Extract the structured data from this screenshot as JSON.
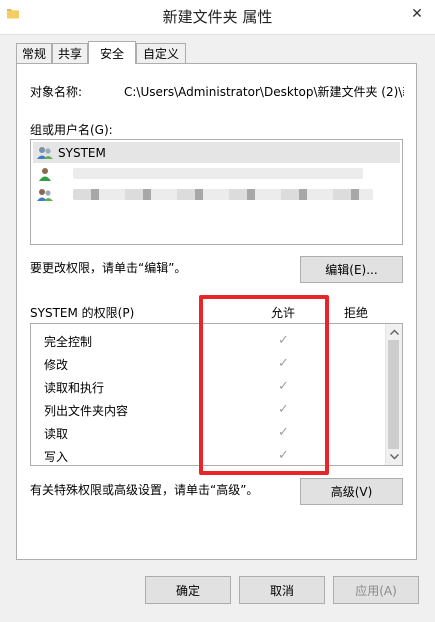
{
  "window": {
    "title": "新建文件夹 属性",
    "close_glyph": "✕"
  },
  "tabs": [
    {
      "label": "常规"
    },
    {
      "label": "共享"
    },
    {
      "label": "安全"
    },
    {
      "label": "自定义"
    }
  ],
  "object": {
    "label": "对象名称:",
    "value": "C:\\Users\\Administrator\\Desktop\\新建文件夹 (2)\\新"
  },
  "groups": {
    "label": "组或用户名(G):",
    "items": [
      {
        "name": "SYSTEM"
      },
      {
        "name": ""
      },
      {
        "name": ""
      }
    ]
  },
  "edit": {
    "hint": "要更改权限，请单击“编辑”。",
    "button": "编辑(E)..."
  },
  "permissions": {
    "title": "SYSTEM 的权限(P)",
    "allow_header": "允许",
    "deny_header": "拒绝",
    "check_glyph": "✓",
    "rows": [
      {
        "name": "完全控制",
        "allow": true
      },
      {
        "name": "修改",
        "allow": true
      },
      {
        "name": "读取和执行",
        "allow": true
      },
      {
        "name": "列出文件夹内容",
        "allow": true
      },
      {
        "name": "读取",
        "allow": true
      },
      {
        "name": "写入",
        "allow": true
      }
    ]
  },
  "advanced": {
    "hint": "有关特殊权限或高级设置，请单击“高级”。",
    "button": "高级(V)"
  },
  "footer": {
    "ok": "确定",
    "cancel": "取消",
    "apply": "应用(A)"
  },
  "colors": {
    "highlight": "#e8262a"
  }
}
